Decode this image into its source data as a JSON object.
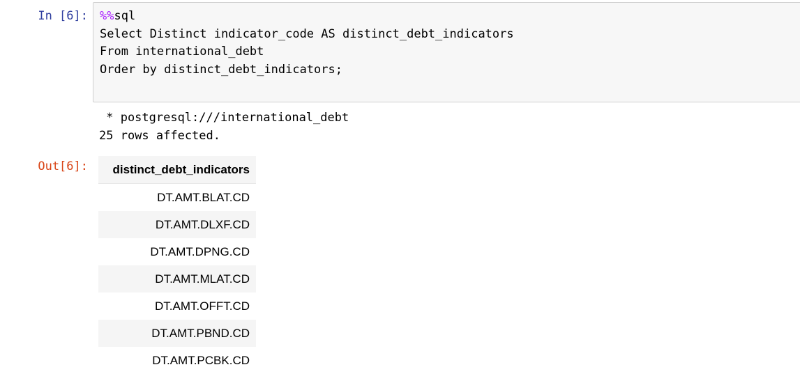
{
  "input_cell": {
    "prompt": "In [6]:",
    "magic": "%%",
    "lines": [
      "sql",
      "Select Distinct indicator_code AS distinct_debt_indicators",
      "From international_debt",
      "Order by distinct_debt_indicators;"
    ]
  },
  "stream_output": {
    "connection": " * postgresql:///international_debt",
    "rows_message": "25 rows affected."
  },
  "output_cell": {
    "prompt": "Out[6]:",
    "table": {
      "header": "distinct_debt_indicators",
      "rows": [
        "DT.AMT.BLAT.CD",
        "DT.AMT.DLXF.CD",
        "DT.AMT.DPNG.CD",
        "DT.AMT.MLAT.CD",
        "DT.AMT.OFFT.CD",
        "DT.AMT.PBND.CD",
        "DT.AMT.PCBK.CD"
      ]
    }
  }
}
